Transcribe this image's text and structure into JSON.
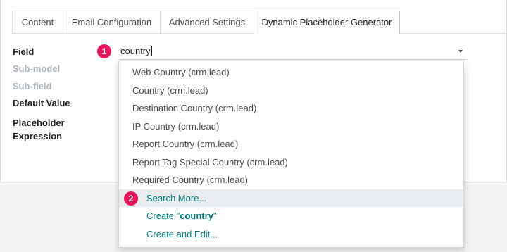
{
  "tabs": [
    {
      "label": "Content"
    },
    {
      "label": "Email Configuration"
    },
    {
      "label": "Advanced Settings"
    },
    {
      "label": "Dynamic Placeholder Generator",
      "active": true
    }
  ],
  "form": {
    "field_label": "Field",
    "submodel_label": "Sub-model",
    "subfield_label": "Sub-field",
    "default_value_label": "Default Value",
    "placeholder_label_line1": "Placeholder",
    "placeholder_label_line2": "Expression",
    "field_value": "country"
  },
  "badges": {
    "one": "1",
    "two": "2"
  },
  "dropdown": {
    "options": [
      "Web Country (crm.lead)",
      "Country (crm.lead)",
      "Destination Country (crm.lead)",
      "IP Country (crm.lead)",
      "Report Country (crm.lead)",
      "Report Tag Special Country (crm.lead)",
      "Required Country (crm.lead)"
    ],
    "search_more": "Search More...",
    "create_prefix": "Create \"",
    "create_term": "country",
    "create_suffix": "\"",
    "create_edit": "Create and Edit..."
  },
  "colors": {
    "accent": "#017e84",
    "badge": "#e8175d",
    "highlight": "#e9ecef"
  }
}
